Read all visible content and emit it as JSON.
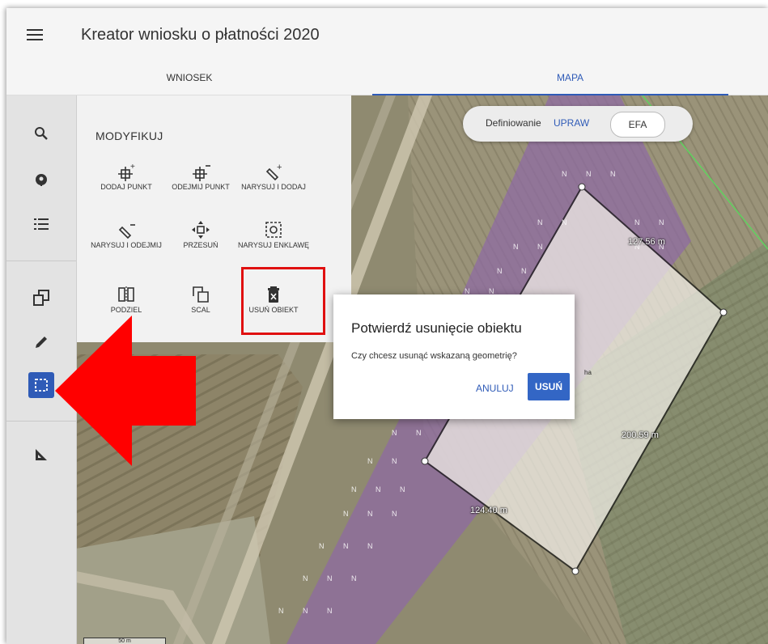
{
  "header": {
    "title": "Kreator wniosku o płatności 2020"
  },
  "tabs": [
    {
      "label": "WNIOSEK"
    },
    {
      "label": "MAPA"
    }
  ],
  "panel": {
    "title": "MODYFIKUJ",
    "tools": [
      {
        "label": "DODAJ PUNKT",
        "icon": "add-point-icon"
      },
      {
        "label": "ODEJMIJ PUNKT",
        "icon": "remove-point-icon"
      },
      {
        "label": "NARYSUJ I DODAJ",
        "icon": "draw-add-icon"
      },
      {
        "label": "NARYSUJ I ODEJMIJ",
        "icon": "draw-subtract-icon"
      },
      {
        "label": "PRZESUŃ",
        "icon": "move-icon"
      },
      {
        "label": "NARYSUJ ENKLAWĘ",
        "icon": "draw-enclave-icon"
      },
      {
        "label": "PODZIEL",
        "icon": "split-icon"
      },
      {
        "label": "SCAL",
        "icon": "merge-icon"
      },
      {
        "label": "USUŃ OBIEKT",
        "icon": "delete-object-icon"
      }
    ]
  },
  "rail": {
    "icons": [
      "search-icon",
      "plant-icon",
      "list-icon",
      "copy-icon",
      "pencil-icon",
      "select-area-icon",
      "ruler-icon"
    ]
  },
  "toggle": {
    "label": "Definiowanie",
    "option1": "UPRAW",
    "option2": "EFA"
  },
  "dialog": {
    "title": "Potwierdź usunięcie obiektu",
    "message": "Czy chcesz usunąć wskazaną geometrię?",
    "cancel": "ANULUJ",
    "confirm": "USUŃ"
  },
  "map": {
    "measurements": [
      "127.56 m",
      "200.59 m",
      "124.40 m"
    ],
    "area_unit": "ha",
    "scale": "50 m",
    "stripe_letter": "N"
  },
  "colors": {
    "accent": "#2f5bb7",
    "highlight": "#e01010",
    "arrow": "#ff0000"
  }
}
